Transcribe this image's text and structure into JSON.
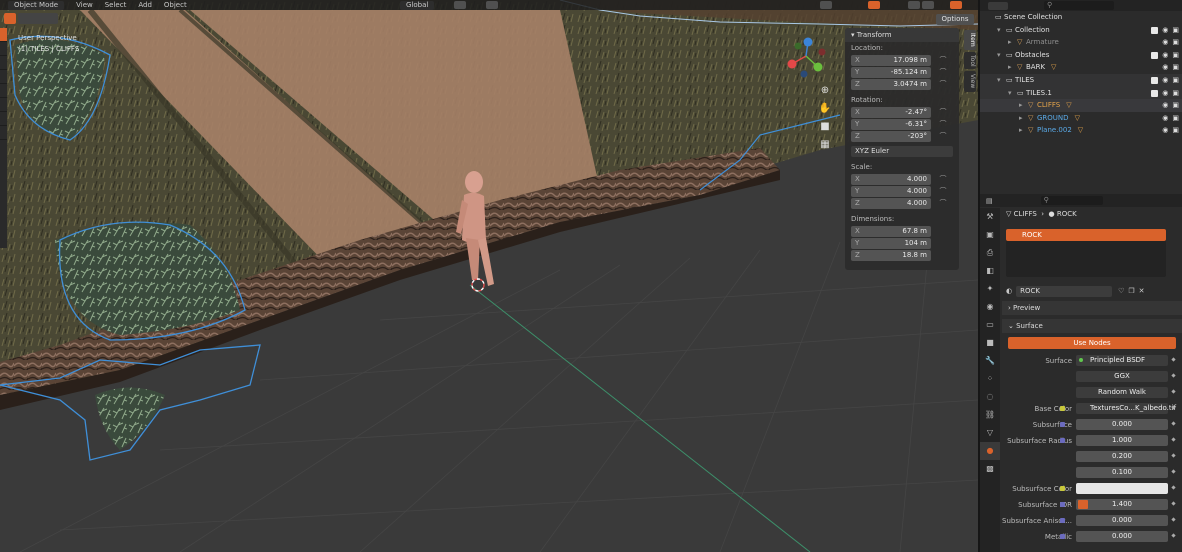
{
  "header": {
    "mode_label": "Object Mode",
    "menus": [
      "View",
      "Select",
      "Add",
      "Object"
    ],
    "orientation": "Global",
    "options_label": "Options"
  },
  "viewport": {
    "view_name": "User Perspective",
    "object_info": "(1) TILES | CLIFFS"
  },
  "side_tabs": [
    "Item",
    "Tool",
    "View"
  ],
  "transform_panel": {
    "title": "Transform",
    "location_label": "Location:",
    "location": [
      {
        "axis": "X",
        "value": "17.098 m"
      },
      {
        "axis": "Y",
        "value": "-85.124 m"
      },
      {
        "axis": "Z",
        "value": "3.0474 m"
      }
    ],
    "rotation_label": "Rotation:",
    "rotation": [
      {
        "axis": "X",
        "value": "-2.47°"
      },
      {
        "axis": "Y",
        "value": "-6.31°"
      },
      {
        "axis": "Z",
        "value": "-203°"
      }
    ],
    "rotation_mode": "XYZ Euler",
    "scale_label": "Scale:",
    "scale": [
      {
        "axis": "X",
        "value": "4.000"
      },
      {
        "axis": "Y",
        "value": "4.000"
      },
      {
        "axis": "Z",
        "value": "4.000"
      }
    ],
    "dimensions_label": "Dimensions:",
    "dimensions": [
      {
        "axis": "X",
        "value": "67.8 m"
      },
      {
        "axis": "Y",
        "value": "104 m"
      },
      {
        "axis": "Z",
        "value": "18.8 m"
      }
    ]
  },
  "outliner": {
    "rows": [
      {
        "name": "Scene Collection",
        "indent": 0,
        "arrow": "",
        "style": "coll"
      },
      {
        "name": "Collection",
        "indent": 1,
        "arrow": "▾",
        "style": "coll"
      },
      {
        "name": "Armature",
        "indent": 2,
        "arrow": "▸",
        "style": "gray"
      },
      {
        "name": "Obstacles",
        "indent": 1,
        "arrow": "▾",
        "style": "coll"
      },
      {
        "name": "BARK",
        "indent": 2,
        "arrow": "▸",
        "style": "coll"
      },
      {
        "name": "TILES",
        "indent": 1,
        "arrow": "▾",
        "style": "coll"
      },
      {
        "name": "TILES.1",
        "indent": 2,
        "arrow": "▾",
        "style": "coll"
      },
      {
        "name": "CLIFFS",
        "indent": 3,
        "arrow": "▸",
        "style": "orange"
      },
      {
        "name": "GROUND",
        "indent": 3,
        "arrow": "▸",
        "style": "blue"
      },
      {
        "name": "Plane.002",
        "indent": 3,
        "arrow": "▸",
        "style": "blue"
      }
    ]
  },
  "properties": {
    "breadcrumb_object": "CLIFFS",
    "breadcrumb_material": "ROCK",
    "slot_name": "ROCK",
    "material_name": "ROCK",
    "preview_label": "Preview",
    "surface_panel_label": "Surface",
    "use_nodes_label": "Use Nodes",
    "rows": [
      {
        "label": "Surface",
        "value": "Principled BSDF"
      },
      {
        "label": "",
        "value": "GGX"
      },
      {
        "label": "",
        "value": "Random Walk"
      },
      {
        "label": "Base Color",
        "value": "TexturesCo...K_albedo.tif"
      },
      {
        "label": "Subsurface",
        "value": "0.000"
      },
      {
        "label": "Subsurface Radius",
        "value": "1.000"
      },
      {
        "label": "",
        "value": "0.200"
      },
      {
        "label": "",
        "value": "0.100"
      },
      {
        "label": "Subsurface Color",
        "value": ""
      },
      {
        "label": "Subsurface IOR",
        "value": "1.400"
      },
      {
        "label": "Subsurface Anisot...",
        "value": "0.000"
      },
      {
        "label": "Metallic",
        "value": "0.000"
      }
    ]
  },
  "colors": {
    "accent": "#d9622b",
    "selection_outline": "#3f8fd8",
    "gizmo_x": "#e34848",
    "gizmo_y": "#6bbf3d",
    "gizmo_z": "#3b84d8"
  }
}
